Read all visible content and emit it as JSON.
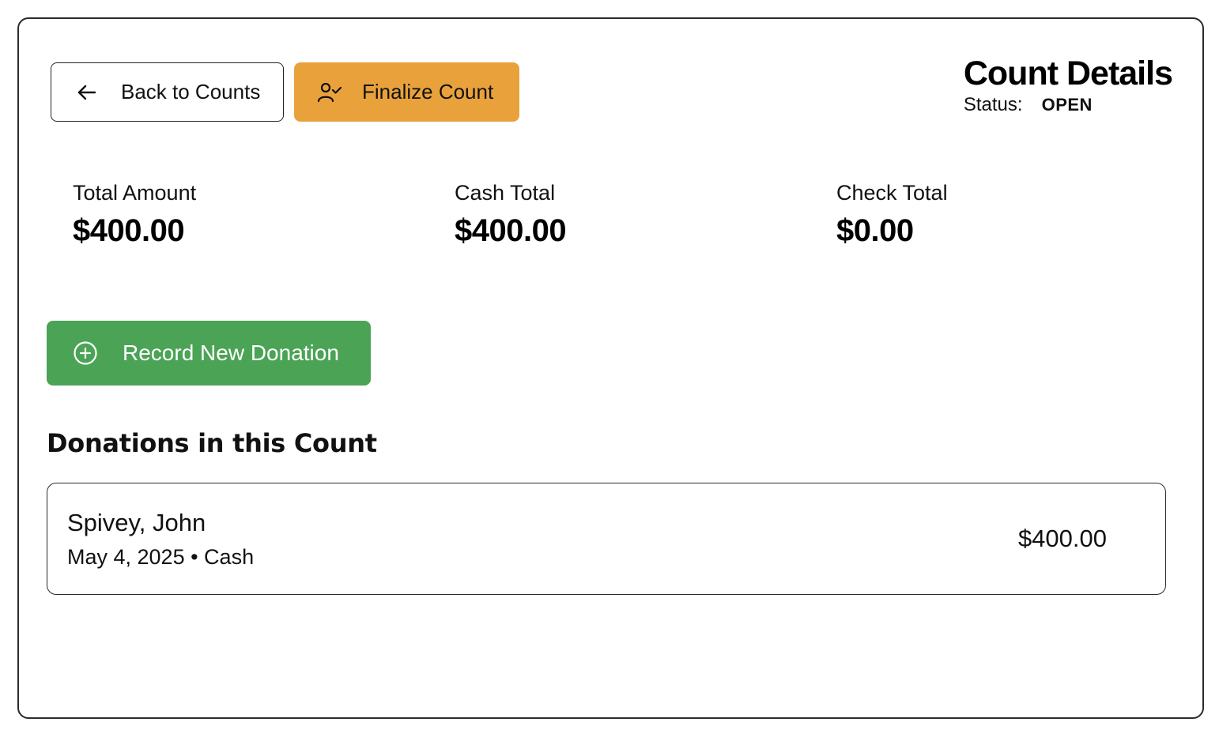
{
  "toolbar": {
    "back_label": "Back to Counts",
    "back_icon": "arrow-left-icon",
    "finalize_label": "Finalize Count",
    "finalize_icon": "user-check-icon"
  },
  "header": {
    "title": "Count Details",
    "status_label": "Status:",
    "status_value": "OPEN"
  },
  "stats": {
    "total_label": "Total Amount",
    "total_value": "$400.00",
    "cash_label": "Cash Total",
    "cash_value": "$400.00",
    "check_label": "Check Total",
    "check_value": "$0.00"
  },
  "actions": {
    "record_label": "Record New Donation",
    "record_icon": "plus-circle-icon"
  },
  "donations": {
    "section_title": "Donations in this Count",
    "items": [
      {
        "name": "Spivey, John",
        "meta": "May 4, 2025 • Cash",
        "amount": "$400.00"
      }
    ]
  },
  "colors": {
    "finalize_bg": "#e9a23b",
    "record_bg": "#4ba356",
    "border": "#2b2b2b"
  }
}
